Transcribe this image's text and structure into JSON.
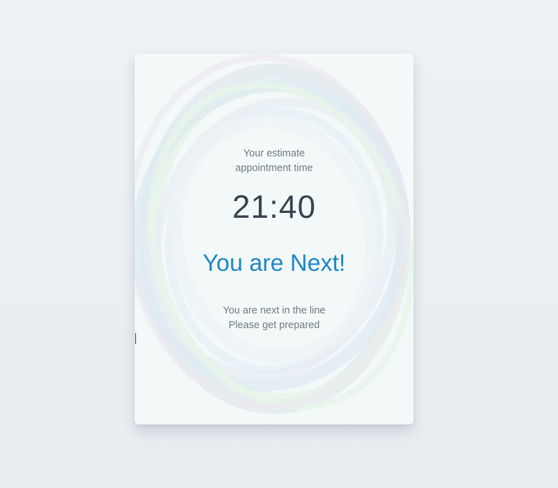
{
  "card": {
    "estimate_label_line1": "Your estimate",
    "estimate_label_line2": "appointment time",
    "time": "21:40",
    "headline": "You are Next!",
    "message_line1": "You are next in the line",
    "message_line2": "Please get prepared"
  },
  "colors": {
    "page_background": "#eaeef1",
    "card_background": "#f3f9f9",
    "headline": "#1f86c6",
    "time": "#37454f",
    "muted_text": "#6f7a80"
  }
}
